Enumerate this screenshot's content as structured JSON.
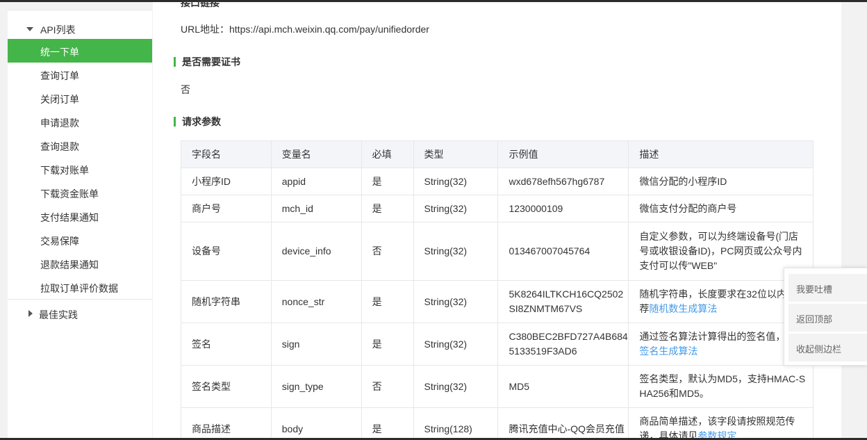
{
  "sidebar": {
    "group_label": "API列表",
    "items": [
      {
        "label": "统一下单",
        "active": true
      },
      {
        "label": "查询订单"
      },
      {
        "label": "关闭订单"
      },
      {
        "label": "申请退款"
      },
      {
        "label": "查询退款"
      },
      {
        "label": "下载对账单"
      },
      {
        "label": "下载资金账单"
      },
      {
        "label": "支付结果通知"
      },
      {
        "label": "交易保障"
      },
      {
        "label": "退款结果通知"
      },
      {
        "label": "拉取订单评价数据"
      }
    ],
    "group2_label": "最佳实践"
  },
  "main": {
    "partial_heading": "接口链接",
    "url_line": "URL地址：https://api.mch.weixin.qq.com/pay/unifiedorder",
    "cert_heading": "是否需要证书",
    "cert_value": "否",
    "params_heading": "请求参数",
    "table": {
      "headers": [
        "字段名",
        "变量名",
        "必填",
        "类型",
        "示例值",
        "描述"
      ],
      "rows": [
        {
          "field": "小程序ID",
          "var": "appid",
          "required": "是",
          "type": "String(32)",
          "example": "wxd678efh567hg6787",
          "desc": "微信分配的小程序ID",
          "desc_link": ""
        },
        {
          "field": "商户号",
          "var": "mch_id",
          "required": "是",
          "type": "String(32)",
          "example": "1230000109",
          "desc": "微信支付分配的商户号",
          "desc_link": ""
        },
        {
          "field": "设备号",
          "var": "device_info",
          "required": "否",
          "type": "String(32)",
          "example": "013467007045764",
          "desc": "自定义参数，可以为终端设备号(门店号或收银设备ID)，PC网页或公众号内支付可以传\"WEB\"",
          "desc_link": ""
        },
        {
          "field": "随机字符串",
          "var": "nonce_str",
          "required": "是",
          "type": "String(32)",
          "example": "5K8264ILTKCH16CQ2502SI8ZNMTM67VS",
          "desc": "随机字符串，长度要求在32位以内。推荐",
          "desc_link": "随机数生成算法"
        },
        {
          "field": "签名",
          "var": "sign",
          "required": "是",
          "type": "String(32)",
          "example": "C380BEC2BFD727A4B6845133519F3AD6",
          "desc": "通过签名算法计算得出的签名值，详见",
          "desc_link": "签名生成算法"
        },
        {
          "field": "签名类型",
          "var": "sign_type",
          "required": "否",
          "type": "String(32)",
          "example": "MD5",
          "desc": "签名类型，默认为MD5，支持HMAC-SHA256和MD5。",
          "desc_link": ""
        },
        {
          "field": "商品描述",
          "var": "body",
          "required": "是",
          "type": "String(128)",
          "example": "腾讯充值中心-QQ会员充值",
          "desc": "商品简单描述，该字段请按照规范传递，具体请见",
          "desc_link": "参数规定"
        }
      ]
    }
  },
  "float_tools": {
    "feedback": "我要吐槽",
    "back_top": "返回顶部",
    "collapse": "收起侧边栏"
  },
  "colors": {
    "accent_green": "#44b549",
    "link_blue": "#459ae9",
    "table_header_bg": "#f4f5f9"
  }
}
